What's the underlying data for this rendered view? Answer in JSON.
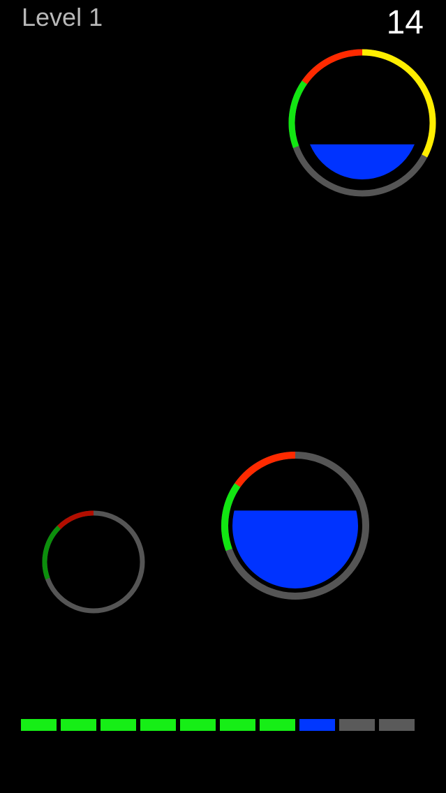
{
  "hud": {
    "level_label": "Level 1",
    "score": "14"
  },
  "colors": {
    "background": "#000000",
    "track": "#555555",
    "red": "#ff2a00",
    "green": "#12e612",
    "yellow": "#ffee00",
    "dark_red": "#b30e00",
    "dark_green": "#0c8f0c",
    "water": "#0033ff",
    "progress_done": "#16ee16",
    "progress_current": "#0037ff",
    "progress_todo": "#5a5a5a"
  },
  "bubbles": [
    {
      "name": "bubble-top-right",
      "fill_fraction": 0.31,
      "arcs": [
        {
          "color": "yellow",
          "start_deg": 0,
          "end_deg": 118
        },
        {
          "color": "red",
          "start_deg": 305,
          "end_deg": 360
        },
        {
          "color": "green",
          "start_deg": 250,
          "end_deg": 305
        }
      ]
    },
    {
      "name": "bubble-bottom-middle",
      "fill_fraction": 0.62,
      "arcs": [
        {
          "color": "red",
          "start_deg": 305,
          "end_deg": 360
        },
        {
          "color": "green",
          "start_deg": 250,
          "end_deg": 305
        }
      ]
    },
    {
      "name": "bubble-bottom-left",
      "fill_fraction": 0,
      "arcs": [
        {
          "color": "dark_red",
          "start_deg": 315,
          "end_deg": 360
        },
        {
          "color": "dark_green",
          "start_deg": 250,
          "end_deg": 315
        }
      ]
    }
  ],
  "progress": {
    "total": 10,
    "completed": 7,
    "current_index": 7
  }
}
